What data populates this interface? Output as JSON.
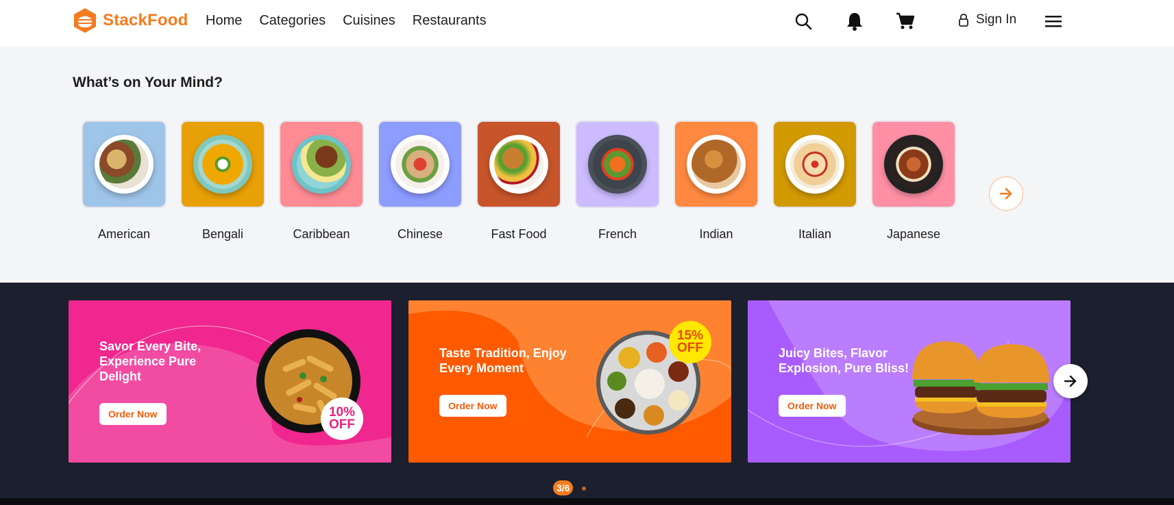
{
  "header": {
    "brand": "StackFood",
    "nav": [
      {
        "label": "Home"
      },
      {
        "label": "Categories"
      },
      {
        "label": "Cuisines"
      },
      {
        "label": "Restaurants"
      }
    ],
    "icons": [
      "search-icon",
      "bell-icon",
      "cart-icon",
      "menu-icon"
    ],
    "sign_in": "Sign In",
    "accent": "#f47c20"
  },
  "mind": {
    "title": "What’s on Your Mind?",
    "categories": [
      {
        "label": "American",
        "bg": "#9ec4e8"
      },
      {
        "label": "Bengali",
        "bg": "#e8a007"
      },
      {
        "label": "Caribbean",
        "bg": "#ff8c94"
      },
      {
        "label": "Chinese",
        "bg": "#8c9cff"
      },
      {
        "label": "Fast Food",
        "bg": "#c8542a"
      },
      {
        "label": "French",
        "bg": "#ccbcff"
      },
      {
        "label": "Indian",
        "bg": "#ff8940"
      },
      {
        "label": "Italian",
        "bg": "#d19a00"
      },
      {
        "label": "Japanese",
        "bg": "#ff8fa5"
      }
    ]
  },
  "banners": [
    {
      "title": "Savor Every Bite, Experience Pure Delight",
      "button": "Order Now",
      "badge_pct": "10%",
      "badge_off": "OFF",
      "bg": "#f0278e"
    },
    {
      "title": "Taste Tradition, Enjoy Every Moment",
      "button": "Order Now",
      "badge_pct": "15%",
      "badge_off": "OFF",
      "bg": "#ff5a00"
    },
    {
      "title": "Juicy Bites, Flavor Explosion, Pure Bliss!",
      "button": "Order Now",
      "bg": "#a85cff"
    }
  ],
  "pager": "3/6"
}
